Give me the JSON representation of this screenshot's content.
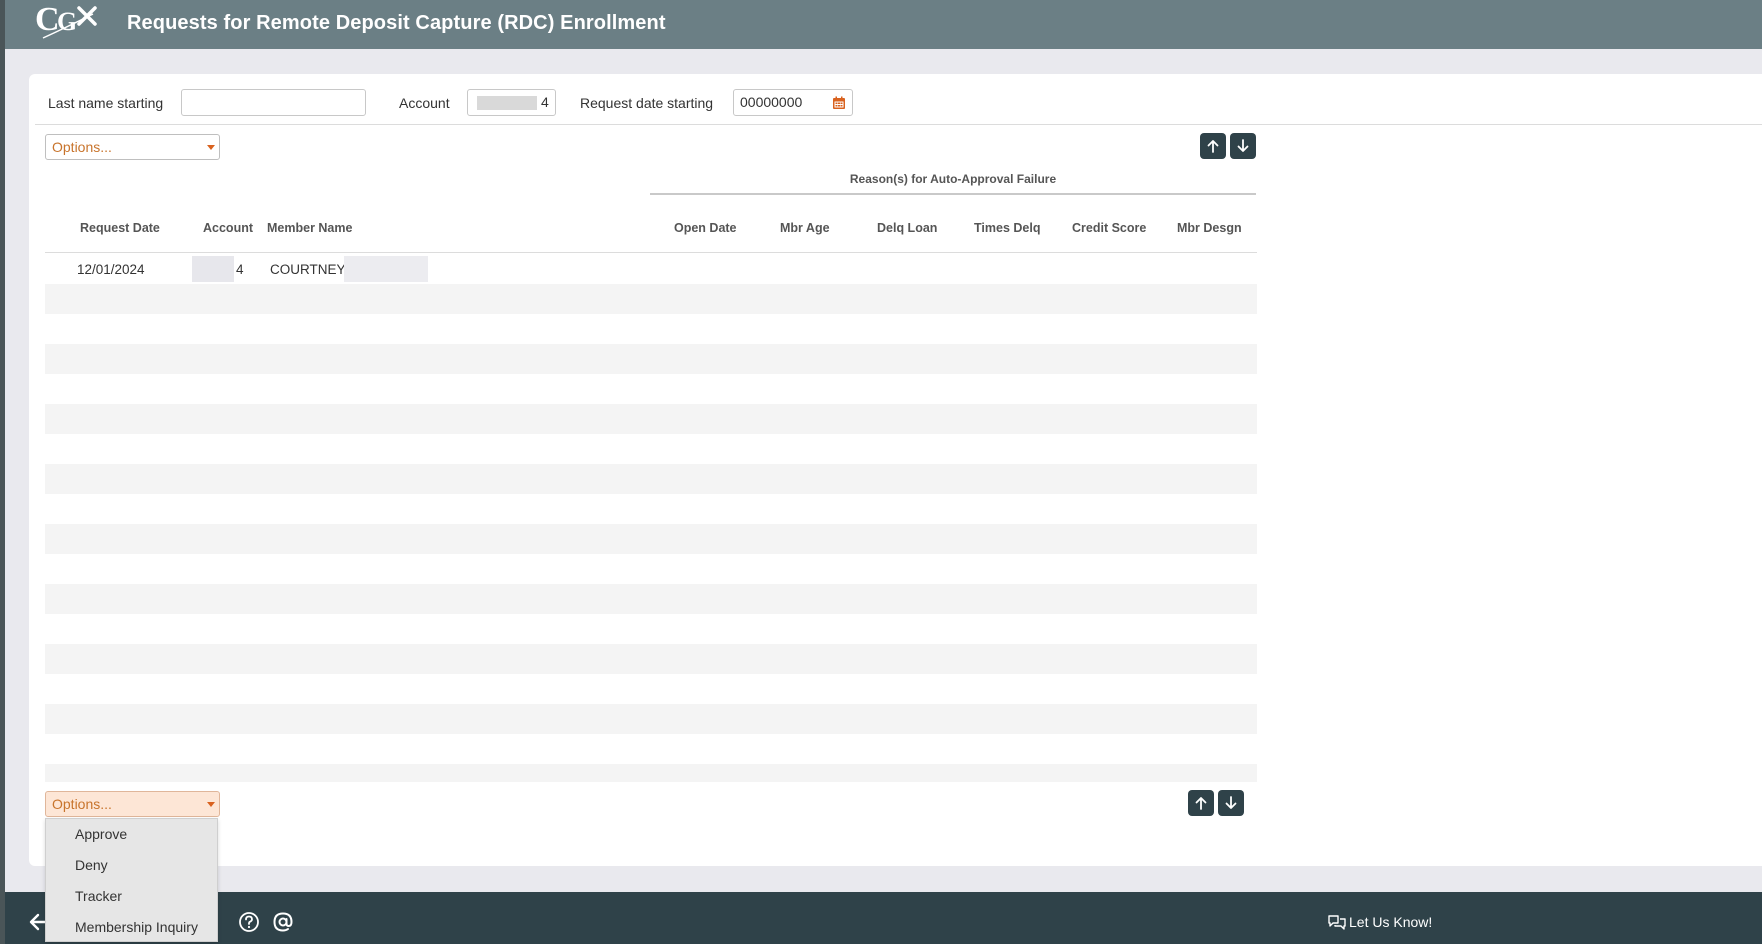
{
  "header": {
    "logo_text": "CGx",
    "title": "Requests for Remote Deposit Capture (RDC) Enrollment"
  },
  "filters": {
    "last_name_label": "Last name starting",
    "last_name_value": "",
    "account_label": "Account",
    "account_value": "4",
    "request_date_label": "Request date starting",
    "request_date_value": "00000000"
  },
  "options": {
    "top_label": "Options...",
    "bottom_label": "Options...",
    "menu_items": [
      "Approve",
      "Deny",
      "Tracker",
      "Membership Inquiry"
    ]
  },
  "table": {
    "group_header": "Reason(s) for Auto-Approval Failure",
    "columns": [
      "Request Date",
      "Account",
      "Member Name",
      "Open Date",
      "Mbr Age",
      "Delq Loan",
      "Times Delq",
      "Credit Score",
      "Mbr Desgn"
    ],
    "rows": [
      {
        "request_date": "12/01/2024",
        "account": "4",
        "member_name": "COURTNEY"
      }
    ]
  },
  "footer": {
    "feedback_label": "Let Us Know!"
  },
  "icons": {
    "sort_up": "arrow-up-icon",
    "sort_down": "arrow-down-icon",
    "calendar": "calendar-icon",
    "back": "back-arrow-icon",
    "help": "help-icon",
    "email": "at-sign-icon",
    "feedback": "chat-bubbles-icon"
  },
  "colors": {
    "header_bg": "#6b7f85",
    "footer_bg": "#2f4249",
    "accent": "#c8742c",
    "button_bg": "#2f4249"
  }
}
